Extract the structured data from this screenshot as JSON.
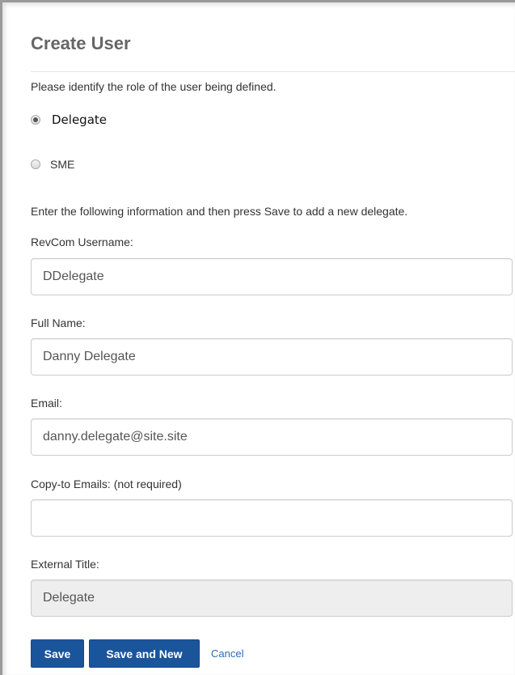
{
  "header": {
    "title": "Create User"
  },
  "role": {
    "prompt": "Please identify the role of the user being defined.",
    "options": [
      {
        "label": "Delegate",
        "selected": true
      },
      {
        "label": "SME",
        "selected": false
      }
    ]
  },
  "instructions": "Enter the following information and then press Save to add a new delegate.",
  "fields": {
    "username": {
      "label": "RevCom Username:",
      "value": "DDelegate"
    },
    "full_name": {
      "label": "Full Name:",
      "value": "Danny Delegate"
    },
    "email": {
      "label": "Email:",
      "value": "danny.delegate@site.site"
    },
    "copy_to": {
      "label": "Copy-to Emails: (not required)",
      "value": ""
    },
    "external_title": {
      "label": "External Title:",
      "value": "Delegate",
      "disabled": true
    }
  },
  "actions": {
    "save_label": "Save",
    "save_new_label": "Save and New",
    "cancel_label": "Cancel"
  },
  "colors": {
    "primary_button": "#1a559c",
    "link": "#2a6db5",
    "title": "#666666"
  }
}
